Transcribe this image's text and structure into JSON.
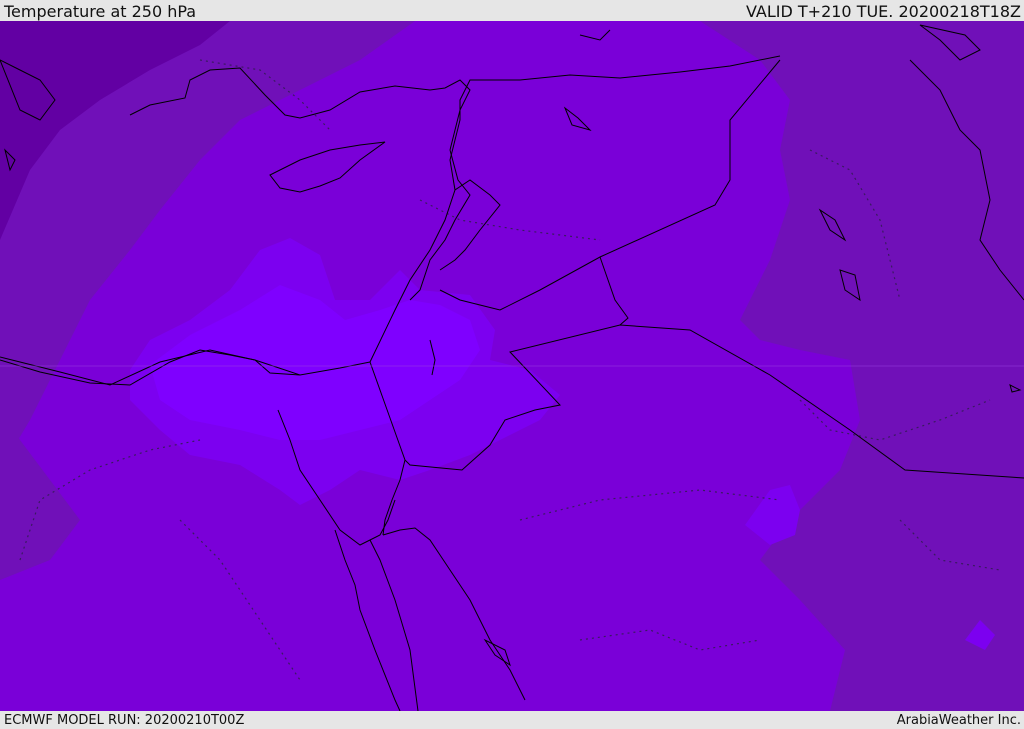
{
  "header": {
    "title": "Temperature at 250 hPa",
    "valid": "VALID T+210 TUE. 20200218T18Z"
  },
  "footer": {
    "model_run": "ECMWF MODEL RUN: 20200210T00Z",
    "credit": "ArabiaWeather Inc."
  },
  "colors": {
    "coldest": "#6200a3",
    "cold": "#7010b8",
    "base": "#7a00d8",
    "warm": "#7c00f0",
    "warmest": "#7f00ff",
    "coastline": "#000000",
    "contour": "#3a1a60"
  }
}
